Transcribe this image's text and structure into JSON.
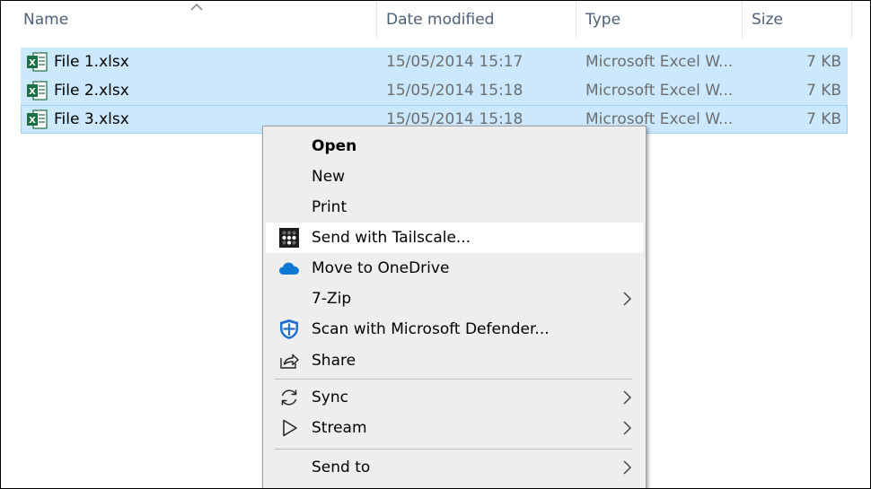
{
  "columns": {
    "name": "Name",
    "date": "Date modified",
    "type": "Type",
    "size": "Size"
  },
  "files": [
    {
      "name": "File 1.xlsx",
      "date": "15/05/2014 15:17",
      "type": "Microsoft Excel W...",
      "size": "7 KB"
    },
    {
      "name": "File 2.xlsx",
      "date": "15/05/2014 15:18",
      "type": "Microsoft Excel W...",
      "size": "7 KB"
    },
    {
      "name": "File 3.xlsx",
      "date": "15/05/2014 15:18",
      "type": "Microsoft Excel W...",
      "size": "7 KB"
    }
  ],
  "context_menu": {
    "items": [
      {
        "label": "Open"
      },
      {
        "label": "New"
      },
      {
        "label": "Print"
      },
      {
        "label": "Send with Tailscale...",
        "icon": "tailscale-icon"
      },
      {
        "label": "Move to OneDrive",
        "icon": "onedrive-cloud-icon"
      },
      {
        "label": "7-Zip"
      },
      {
        "label": "Scan with Microsoft Defender...",
        "icon": "defender-shield-icon"
      },
      {
        "label": "Share",
        "icon": "share-icon"
      },
      {
        "label": "Sync",
        "icon": "sync-icon"
      },
      {
        "label": "Stream",
        "icon": "play-icon"
      },
      {
        "label": "Send to"
      }
    ]
  },
  "colors": {
    "selection": "#cce8ff",
    "selection_border": "#99d1ff",
    "menu_bg": "#eeeeee",
    "excel_green": "#1d6f42",
    "onedrive_blue": "#0f78d4",
    "defender_blue": "#1f6fd1"
  }
}
